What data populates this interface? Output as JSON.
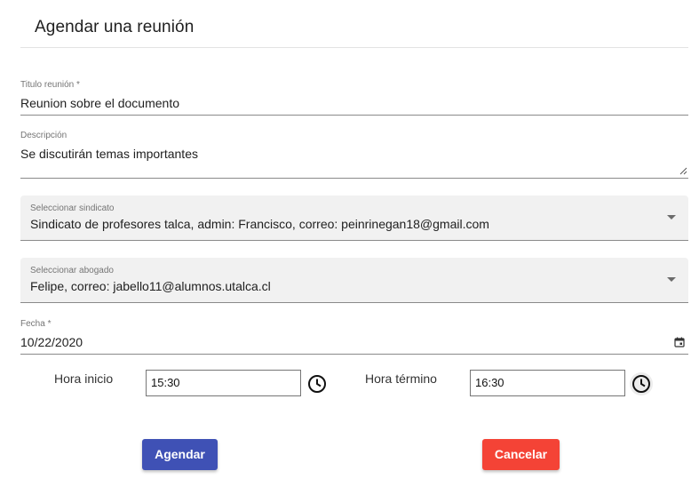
{
  "dialog": {
    "title": "Agendar una reunión"
  },
  "form": {
    "titulo": {
      "label": "Titulo reunión *",
      "value": "Reunion sobre el documento"
    },
    "descripcion": {
      "label": "Descripción",
      "value": "Se discutirán temas importantes"
    },
    "sindicato": {
      "label": "Seleccionar sindicato",
      "value": "Sindicato de profesores talca, admin: Francisco, correo: peinrinegan18@gmail.com"
    },
    "abogado": {
      "label": "Seleccionar abogado",
      "value": "Felipe, correo: jabello11@alumnos.utalca.cl"
    },
    "fecha": {
      "label": "Fecha *",
      "value": "10/22/2020"
    },
    "hora_inicio": {
      "label": "Hora inicio",
      "value": "15:30"
    },
    "hora_termino": {
      "label": "Hora término",
      "value": "16:30"
    }
  },
  "actions": {
    "agendar_label": "Agendar",
    "cancelar_label": "Cancelar"
  },
  "colors": {
    "primary": "#3f51b5",
    "danger": "#f44336"
  },
  "icons": {
    "select_arrow": "chevron-down-icon",
    "calendar": "calendar-icon",
    "clock": "clock-icon",
    "resize": "resize-handle-icon"
  }
}
